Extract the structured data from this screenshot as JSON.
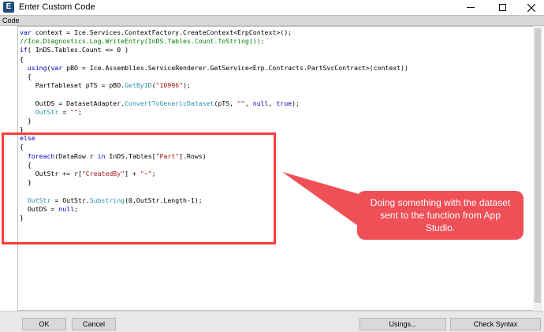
{
  "window": {
    "title": "Enter Custom Code",
    "app_icon": "E"
  },
  "section": {
    "label": "Code"
  },
  "code_lines": [
    [
      {
        "t": "var",
        "c": "kw"
      },
      {
        "t": " context = Ice.Services.ContextFactory.CreateContext<ErpContext>();",
        "c": ""
      }
    ],
    [
      {
        "t": "//Ice.Diagnostics.Log.WriteEntry(InDS.Tables.Count.ToString());",
        "c": "cm"
      }
    ],
    [
      {
        "t": "if",
        "c": "kw"
      },
      {
        "t": "( InDS.Tables.Count <= 0 )",
        "c": ""
      }
    ],
    [
      {
        "t": "{",
        "c": ""
      }
    ],
    [
      {
        "t": "  ",
        "c": ""
      },
      {
        "t": "using",
        "c": "kw"
      },
      {
        "t": "(",
        "c": ""
      },
      {
        "t": "var",
        "c": "kw"
      },
      {
        "t": " pBO = Ice.Assemblies.ServiceRenderer.GetService<Erp.Contracts.PartSvcContract>(context))",
        "c": ""
      }
    ],
    [
      {
        "t": "  {",
        "c": ""
      }
    ],
    [
      {
        "t": "    PartTableset pTS = pBO.",
        "c": ""
      },
      {
        "t": "GetByID",
        "c": "tp"
      },
      {
        "t": "(",
        "c": ""
      },
      {
        "t": "\"10996\"",
        "c": "str"
      },
      {
        "t": ");",
        "c": ""
      }
    ],
    [
      {
        "t": "",
        "c": ""
      }
    ],
    [
      {
        "t": "    OutDS = DatasetAdapter.",
        "c": ""
      },
      {
        "t": "ConvertToGenericDataset",
        "c": "tp"
      },
      {
        "t": "(pTS, ",
        "c": ""
      },
      {
        "t": "\"\"",
        "c": "str"
      },
      {
        "t": ", ",
        "c": ""
      },
      {
        "t": "null",
        "c": "kw"
      },
      {
        "t": ", ",
        "c": ""
      },
      {
        "t": "true",
        "c": "kw"
      },
      {
        "t": ");",
        "c": ""
      }
    ],
    [
      {
        "t": "    ",
        "c": ""
      },
      {
        "t": "OutStr",
        "c": "tp"
      },
      {
        "t": " = ",
        "c": ""
      },
      {
        "t": "\"\"",
        "c": "str"
      },
      {
        "t": ";",
        "c": ""
      }
    ],
    [
      {
        "t": "  }",
        "c": ""
      }
    ],
    [
      {
        "t": "}",
        "c": ""
      }
    ],
    [
      {
        "t": "else",
        "c": "kw"
      }
    ],
    [
      {
        "t": "{",
        "c": ""
      }
    ],
    [
      {
        "t": "  ",
        "c": ""
      },
      {
        "t": "foreach",
        "c": "kw"
      },
      {
        "t": "(DataRow r ",
        "c": ""
      },
      {
        "t": "in",
        "c": "kw"
      },
      {
        "t": " InDS.Tables[",
        "c": ""
      },
      {
        "t": "\"Part\"",
        "c": "str"
      },
      {
        "t": "].Rows)",
        "c": ""
      }
    ],
    [
      {
        "t": "  {",
        "c": ""
      }
    ],
    [
      {
        "t": "    OutStr += r[",
        "c": ""
      },
      {
        "t": "\"CreatedBy\"",
        "c": "str"
      },
      {
        "t": "] + ",
        "c": ""
      },
      {
        "t": "\"~\"",
        "c": "str"
      },
      {
        "t": ";",
        "c": ""
      }
    ],
    [
      {
        "t": "  }",
        "c": ""
      }
    ],
    [
      {
        "t": "",
        "c": ""
      }
    ],
    [
      {
        "t": "  ",
        "c": ""
      },
      {
        "t": "OutStr",
        "c": "tp"
      },
      {
        "t": " = OutStr.",
        "c": ""
      },
      {
        "t": "Substring",
        "c": "tp"
      },
      {
        "t": "(0,OutStr.Length-1);",
        "c": ""
      }
    ],
    [
      {
        "t": "  OutDS = ",
        "c": ""
      },
      {
        "t": "null",
        "c": "kw"
      },
      {
        "t": ";",
        "c": ""
      }
    ],
    [
      {
        "t": "}",
        "c": ""
      }
    ]
  ],
  "callout": {
    "text": "Doing something with the dataset sent to the function from App Studio."
  },
  "buttons": {
    "ok": "OK",
    "cancel": "Cancel",
    "usings": "Usings...",
    "check_syntax": "Check Syntax"
  },
  "colors": {
    "highlight": "#ff3d3d",
    "callout": "#ef4f56",
    "keyword": "#0000cc",
    "comment": "#008000",
    "string": "#a31515"
  }
}
